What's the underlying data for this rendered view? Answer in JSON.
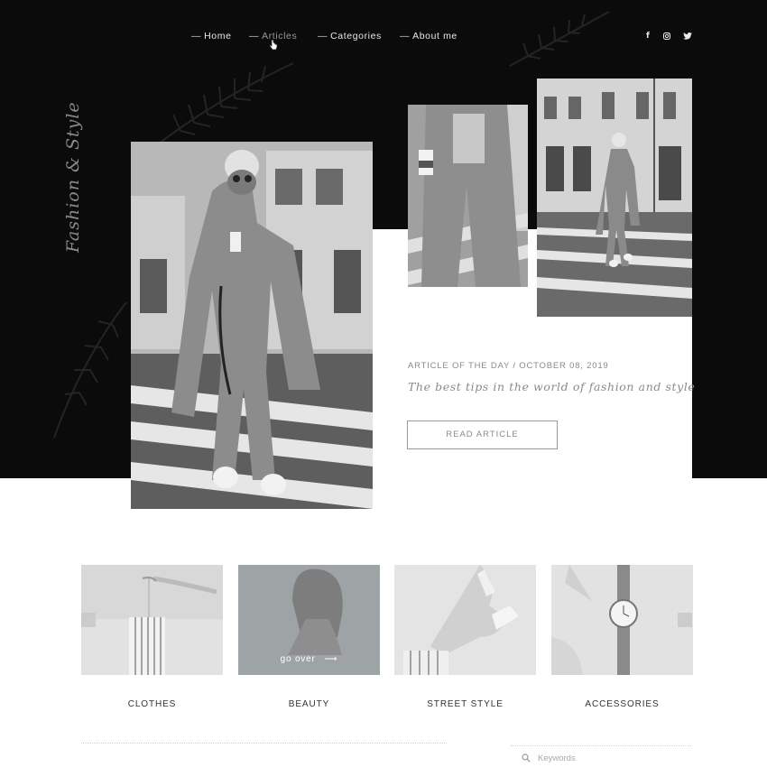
{
  "nav": {
    "items": [
      {
        "label": "Home",
        "active": false
      },
      {
        "label": "Articles",
        "active": true
      },
      {
        "label": "Categories",
        "active": false
      },
      {
        "label": "About me",
        "active": false
      }
    ],
    "dash": "—"
  },
  "social": {
    "facebook": "f",
    "instagram_icon": "instagram-icon",
    "twitter_icon": "twitter-icon"
  },
  "brand": {
    "script_title": "Fashion & Style"
  },
  "feature": {
    "meta": "ARTICLE OF THE DAY / OCTOBER 08, 2019",
    "tagline": "The best tips in the world of fashion and style",
    "button_label": "READ ARTICLE"
  },
  "categories": [
    {
      "label": "CLOTHES"
    },
    {
      "label": "BEAUTY",
      "hover_text": "go over",
      "hover_arrow": "⟶"
    },
    {
      "label": "STREET STYLE"
    },
    {
      "label": "ACCESSORIES"
    }
  ],
  "search": {
    "placeholder": "Keywords"
  },
  "colors": {
    "hero_background": "#0b0b0b",
    "muted_text": "#8a8a8a",
    "accent_gray": "#9ea3a5"
  }
}
